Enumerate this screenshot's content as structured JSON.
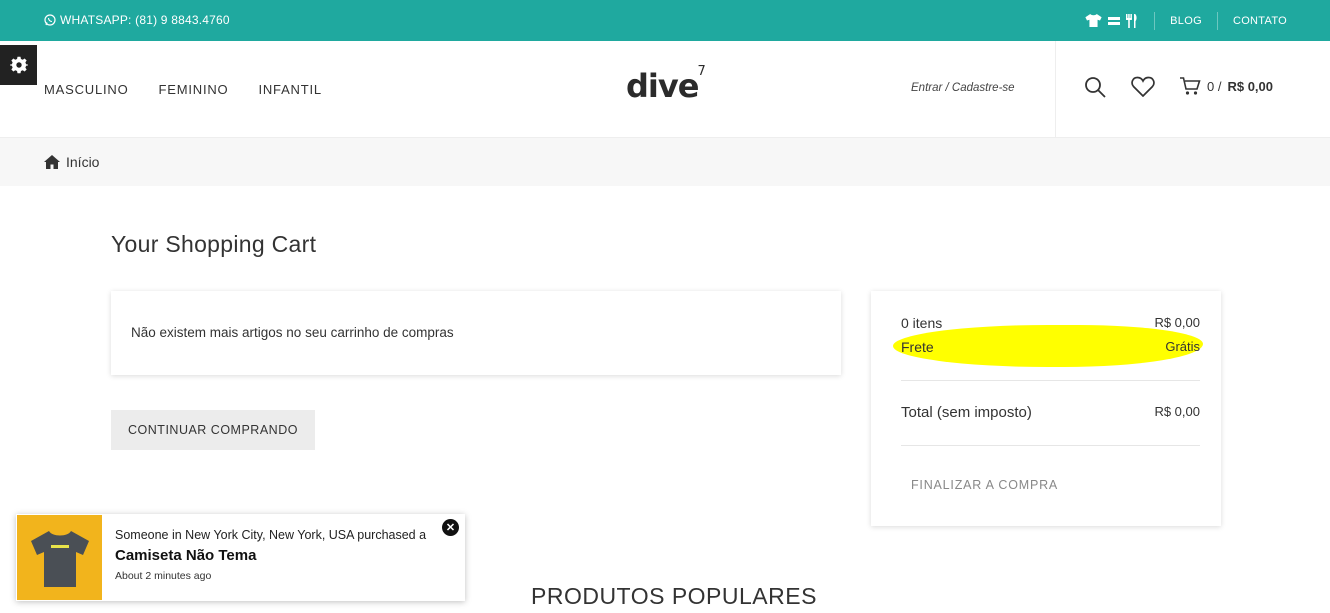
{
  "topbar": {
    "whatsapp": "WHATSAPP: (81) 9 8843.4760",
    "links": [
      "BLOG",
      "CONTATO"
    ],
    "icons": [
      "tshirt-icon",
      "equals-icon",
      "utensils-icon"
    ],
    "bg_color": "#1fa99f"
  },
  "header": {
    "nav": [
      "MASCULINO",
      "FEMININO",
      "INFANTIL"
    ],
    "logo_text": "dive",
    "logo_sup": "7",
    "login": "Entrar / Cadastre-se",
    "cart_count": "0 /",
    "cart_total": "R$ 0,00"
  },
  "breadcrumb": {
    "home": "Início"
  },
  "cart": {
    "title": "Your Shopping Cart",
    "empty_message": "Não existem mais artigos no seu carrinho de compras",
    "continue_button": "CONTINUAR COMPRANDO"
  },
  "summary": {
    "items_label": "0 itens",
    "items_value": "R$ 0,00",
    "shipping_label": "Frete",
    "shipping_value": "Grátis",
    "total_label": "Total (sem imposto)",
    "total_value": "R$ 0,00",
    "checkout_button": "FINALIZAR A COMPRA",
    "highlight_color": "#ffff00"
  },
  "popular_title": "PRODUTOS POPULARES",
  "toast": {
    "line1": "Someone in New York City, New York, USA purchased a",
    "product": "Camiseta Não Tema",
    "time": "About 2 minutes ago",
    "thumb_bg": "#f2b41c"
  }
}
